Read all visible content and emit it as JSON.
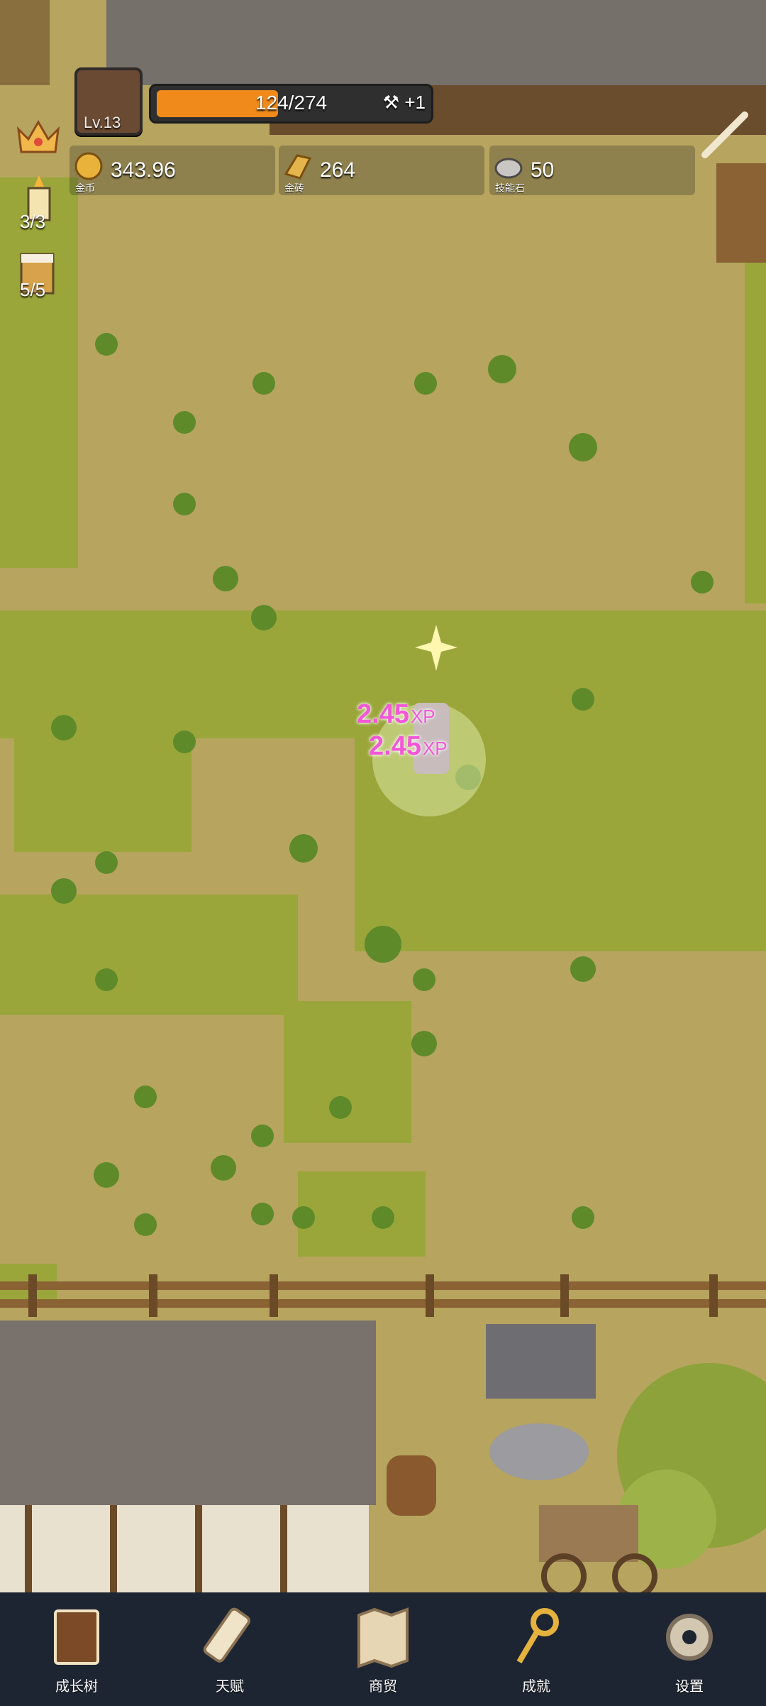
{
  "hud": {
    "level": "Lv.13",
    "xp_text": "124/274",
    "xp_fraction": 0.45,
    "xp_bonus": "+1"
  },
  "resources": [
    {
      "value": "343.96",
      "label": "金币",
      "icon": "gold-coin-icon"
    },
    {
      "value": "264",
      "label": "金砖",
      "icon": "gold-brick-icon"
    },
    {
      "value": "50",
      "label": "技能石",
      "icon": "skill-stone-icon"
    }
  ],
  "side": {
    "candle_count": "3/3",
    "beer_count": "5/5"
  },
  "popups": [
    {
      "value": "2.45",
      "unit": "XP"
    },
    {
      "value": "2.45",
      "unit": "XP"
    }
  ],
  "nav": [
    {
      "label": "成长树",
      "icon": "book-icon"
    },
    {
      "label": "天赋",
      "icon": "scroll-icon"
    },
    {
      "label": "商贸",
      "icon": "map-icon"
    },
    {
      "label": "成就",
      "icon": "key-icon"
    },
    {
      "label": "设置",
      "icon": "gear-icon"
    }
  ],
  "colors": {
    "dirt": "#b6a45f",
    "grass": "#9aa63a",
    "xp_fill": "#f08a1b",
    "popup": "#f257d6",
    "nav_bg": "#1d2532"
  }
}
